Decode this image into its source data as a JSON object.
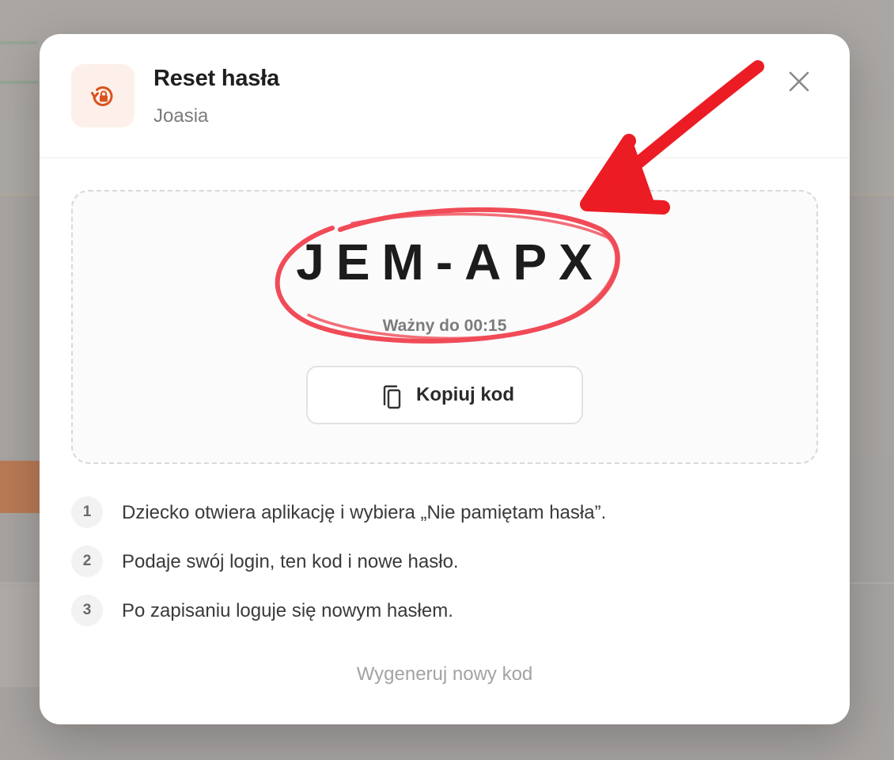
{
  "modal": {
    "title": "Reset hasła",
    "subtitle": "Joasia"
  },
  "code_panel": {
    "code": "JEM-APX",
    "valid_until": "Ważny do 00:15",
    "copy_label": "Kopiuj kod"
  },
  "steps": [
    {
      "number": "1",
      "text": "Dziecko otwiera aplikację i wybiera „Nie pamiętam hasła”."
    },
    {
      "number": "2",
      "text": "Podaje swój login, ten kod i nowe hasło."
    },
    {
      "number": "3",
      "text": "Po zapisaniu loguje się nowym hasłem."
    }
  ],
  "regenerate_label": "Wygeneruj nowy kod",
  "icons": {
    "header": "lock-reset-icon",
    "close": "close-icon",
    "copy": "copy-icon"
  },
  "colors": {
    "accent": "#d9531e",
    "accent_bg": "#fdf0ea",
    "annotation_red": "#ec1c24",
    "annotation_circle": "#f04b57"
  }
}
